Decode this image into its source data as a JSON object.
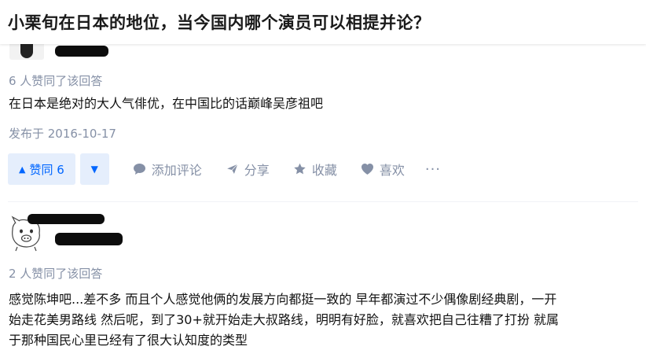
{
  "question": {
    "title": "小栗旬在日本的地位，当今国内哪个演员可以相提并论？"
  },
  "answers": [
    {
      "vote_summary": "6 人赞同了该回答",
      "content": "在日本是绝对的大人气俳优，在中国比的话巅峰吴彦祖吧",
      "posted": "发布于 2016-10-17",
      "actions": {
        "upvote_label": "赞同 6",
        "comment_label": "添加评论",
        "share_label": "分享",
        "collect_label": "收藏",
        "like_label": "喜欢",
        "more_label": "···"
      }
    },
    {
      "vote_summary": "2 人赞同了该回答",
      "content_lines": [
        "感觉陈坤吧...差不多 而且个人感觉他俩的发展方向都挺一致的 早年都演过不少偶像剧经典剧，一开",
        "始走花美男路线 然后呢，到了30+就开始走大叔路线，明明有好脸，就喜欢把自己往糟了打扮 就属",
        "于那种国民心里已经有了很大认知度的类型"
      ]
    }
  ],
  "colors": {
    "accent": "#0066ff",
    "accent_bg": "#e5eefc",
    "meta_text": "#8590a6",
    "body_text": "#121212"
  },
  "icons": {
    "upvote": "triangle-up-icon",
    "downvote": "triangle-down-icon",
    "comment": "comment-bubble-icon",
    "share": "paper-plane-icon",
    "collect": "star-icon",
    "like": "heart-icon",
    "more": "ellipsis-icon"
  }
}
